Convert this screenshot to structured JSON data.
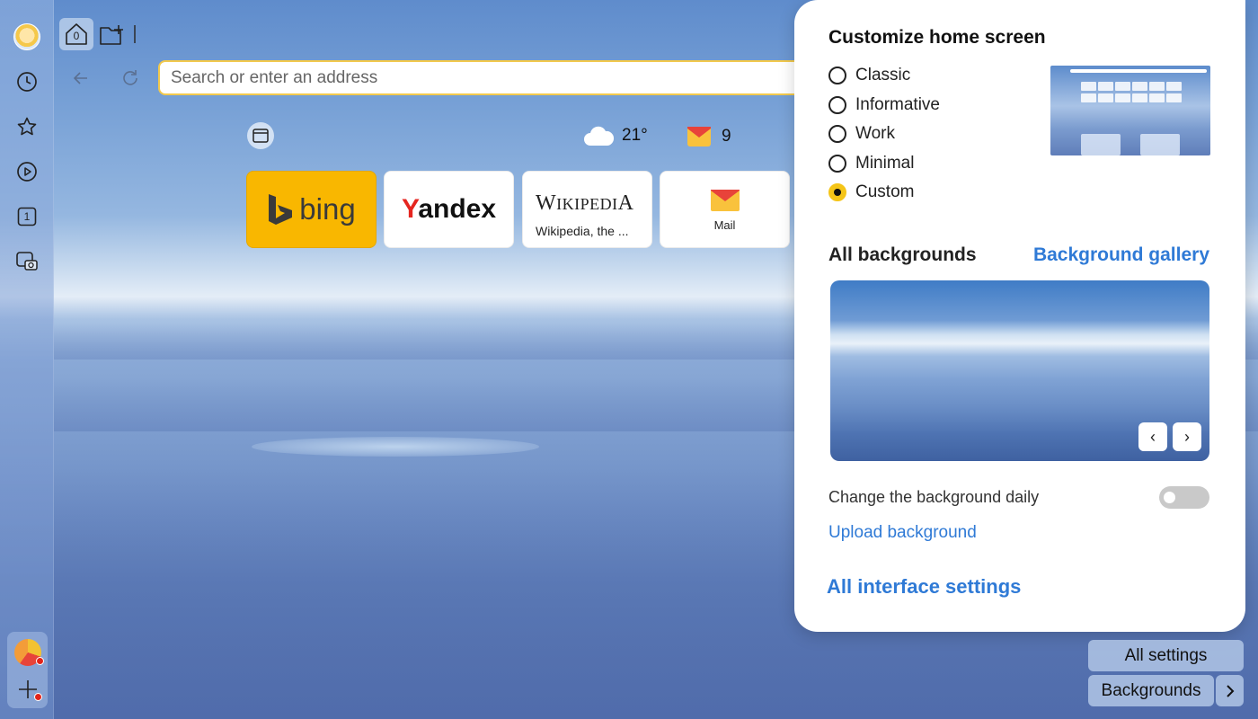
{
  "tabs": {
    "home_count": "0"
  },
  "address": {
    "placeholder": "Search or enter an address"
  },
  "widgets": {
    "temperature": "21°",
    "mail_count": "9"
  },
  "tiles": [
    {
      "label": "bing"
    },
    {
      "label": "Yandex"
    },
    {
      "label": "Wikipedia",
      "subtitle": "Wikipedia, the ..."
    },
    {
      "label": "Mail"
    }
  ],
  "sidebar": {
    "tab_count_badge": "1"
  },
  "panel": {
    "title": "Customize home screen",
    "layouts": [
      "Classic",
      "Informative",
      "Work",
      "Minimal",
      "Custom"
    ],
    "selected_layout": "Custom",
    "backgrounds_heading": "All backgrounds",
    "gallery_link": "Background gallery",
    "daily_label": "Change the background daily",
    "daily_enabled": false,
    "upload_link": "Upload background",
    "all_interface_link": "All interface settings"
  },
  "bottom": {
    "all_settings": "All settings",
    "backgrounds": "Backgrounds"
  },
  "colors": {
    "accent_yellow": "#f5c518",
    "link_blue": "#2f7ad6",
    "bing_tile": "#f9b700",
    "yandex_red": "#e52620"
  }
}
